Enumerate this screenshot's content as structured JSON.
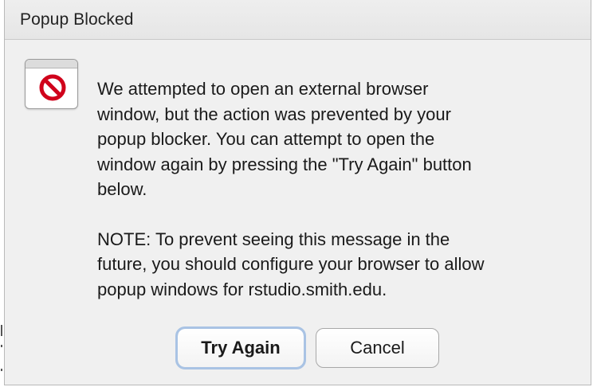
{
  "dialog": {
    "title": "Popup Blocked",
    "icon": "blocked-window-icon",
    "message_paragraph_1": "We attempted to open an external browser\nwindow, but the action was prevented by your\npopup blocker. You can attempt to open the\nwindow again by pressing the \"Try Again\" button\nbelow.",
    "message_paragraph_2": "NOTE: To prevent seeing this message in the\nfuture, you should configure your browser to allow\npopup windows for rstudio.smith.edu.",
    "try_again_label": "Try Again",
    "cancel_label": "Cancel"
  },
  "colors": {
    "dialog_background": "#f0f0f0",
    "icon_red": "#d0021b",
    "focus_ring": "#a9c3e4"
  }
}
